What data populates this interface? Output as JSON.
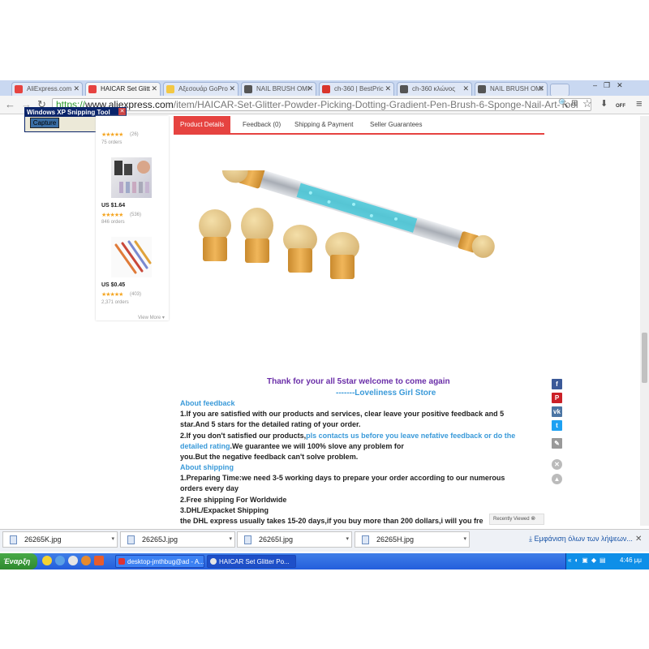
{
  "browser": {
    "tabs": [
      {
        "label": "AliExpress.com",
        "fav": "#e64340",
        "active": false
      },
      {
        "label": "HAICAR Set Glitt",
        "fav": "#e64340",
        "active": true
      },
      {
        "label": "Αξεσουάρ GoPro",
        "fav": "#f3c844",
        "active": false
      },
      {
        "label": "NAIL BRUSH OMI",
        "fav": "#555555",
        "active": false
      },
      {
        "label": "ch-360 | BestPric",
        "fav": "#d9352b",
        "active": false
      },
      {
        "label": "ch-360 κλώνος",
        "fav": "#555555",
        "active": false
      },
      {
        "label": "NAIL BRUSH OMI",
        "fav": "#555555",
        "active": false
      }
    ],
    "address": {
      "scheme": "https://",
      "host": "www.aliexpress.com",
      "path": "/item/HAICAR-Set-Glitter-Powder-Picking-Dotting-Gradient-Pen-Brush-6-Sponge-Nail-Art-Tool"
    },
    "off_badge": "OFF"
  },
  "snipping_tool": {
    "title": "Windows XP Snipping Tool",
    "button": "Capture"
  },
  "sidebar": {
    "items": [
      {
        "price": "",
        "stars": "★★★★★",
        "rating": "(26)",
        "orders": "75 orders"
      },
      {
        "price": "US $1.64",
        "stars": "★★★★★",
        "rating": "(536)",
        "orders": "846 orders"
      },
      {
        "price": "US $0.45",
        "stars": "★★★★★",
        "rating": "(403)",
        "orders": "2,371 orders"
      }
    ],
    "view_more": "View More ▾"
  },
  "product_tabs": {
    "details": "Product Details",
    "feedback": "Feedback (0)",
    "shipping": "Shipping & Payment",
    "guarantees": "Seller Guarantees"
  },
  "description": {
    "thanks": "Thank for your all 5star welcome to come again",
    "store": "-------Loveliness Girl Store",
    "about_feedback": "About feedback",
    "fb1": " 1.If you are satisfied with our products and services, clear leave your positive feedback and 5",
    "fb1b": "star.And 5 stars for the detailed rating of your order.",
    "fb2a": "2.If you don't satisfied our products,",
    "fb2b": "pls contacts us before you leave nefative feedback or do the",
    "fb2c": "detailed rating",
    "fb2d": ".We guarantee we will 100% slove any problem for",
    "fb2e": "you.But the negative feedback can't solve problem.",
    "about_shipping": "About shipping",
    "sh1": "1.Preparing Time:we need 3-5 working days to prepare your order according to our numerous",
    "sh1b": "orders every day",
    "sh2": "2.Free shipping For Worldwide",
    "sh3": "3.DHL/Expacket Shipping",
    "sh4": "the DHL express usually takes 15-20 days,if you buy more than 200 dollars,i will you fre"
  },
  "recently_viewed": "Recently Viewed",
  "downloads": {
    "items": [
      "26265K.jpg",
      "26265J.jpg",
      "26265I.jpg",
      "26265H.jpg"
    ],
    "show_all": "Εμφάνιση όλων των λήψεων..."
  },
  "taskbar": {
    "start": "Έναρξη",
    "tasks": [
      "desktop-jmthbug@ad - A...",
      "HAICAR Set Glitter Po..."
    ],
    "clock": "4:46 μμ"
  }
}
